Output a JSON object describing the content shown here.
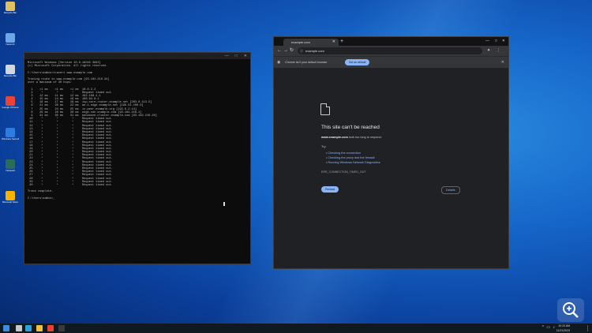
{
  "desktop": {
    "icons": [
      {
        "name": "Recycle Bin",
        "color": "#e0c060"
      },
      {
        "name": "Network",
        "color": "#6aa8e8"
      },
      {
        "name": "Recycle Bin",
        "color": "#cfd8e0"
      },
      {
        "name": "Google Chrome",
        "color": "#ea4335"
      },
      {
        "name": "Windows Security",
        "color": "#2d7de0"
      },
      {
        "name": "Notepad",
        "color": "#2a6b5a"
      },
      {
        "name": "Microsoft Store",
        "color": "#f4b400"
      }
    ]
  },
  "terminal": {
    "title_buttons": [
      "—",
      "□",
      "✕"
    ],
    "lines": [
      "Microsoft Windows [Version 10.0.19045.3693]",
      "(c) Microsoft Corporation. All rights reserved.",
      "",
      "C:\\Users\\admin>tracert www.example.com",
      "",
      "Tracing route to www.example.com [93.184.216.34]",
      "over a maximum of 30 hops:",
      "",
      "  1    <1 ms    <1 ms    <1 ms  10.0.2.2",
      "  2     *        *        *     Request timed out.",
      "  3    12 ms    11 ms    12 ms  192.168.1.1",
      "  4    15 ms    14 ms    16 ms  100.64.0.1",
      "  5    18 ms    17 ms    18 ms  isp-core-router.example.net [203.0.113.5]",
      "  6    21 ms    20 ms    22 ms  ae-1.edge.example.net [198.51.100.9]",
      "  7    25 ms    24 ms    25 ms  ix-peer.example.org [192.0.2.14]",
      "  8    29 ms    28 ms    30 ms  edge-cdn.example.com [93.184.216.1]",
      "  9    31 ms    30 ms    31 ms  backbone-cluster.example.com [93.184.216.20]",
      " 10     *        *        *     Request timed out.",
      " 11     *        *        *     Request timed out.",
      " 12     *        *        *     Request timed out.",
      " 13     *        *        *     Request timed out.",
      " 14     *        *        *     Request timed out.",
      " 15     *        *        *     Request timed out.",
      " 16     *        *        *     Request timed out.",
      " 17     *        *        *     Request timed out.",
      " 18     *        *        *     Request timed out.",
      " 19     *        *        *     Request timed out.",
      " 20     *        *        *     Request timed out.",
      " 21     *        *        *     Request timed out.",
      " 22     *        *        *     Request timed out.",
      " 23     *        *        *     Request timed out.",
      " 24     *        *        *     Request timed out.",
      " 25     *        *        *     Request timed out.",
      " 26     *        *        *     Request timed out.",
      " 27     *        *        *     Request timed out.",
      " 28     *        *        *     Request timed out.",
      " 29     *        *        *     Request timed out.",
      " 30     *        *        *     Request timed out.",
      "",
      "Trace complete.",
      "",
      "C:\\Users\\admin>_"
    ]
  },
  "browser": {
    "tab_title": "example.com",
    "tab_close": "✕",
    "new_tab": "+",
    "window_buttons": [
      "—",
      "□",
      "✕"
    ],
    "nav": {
      "back": "←",
      "forward": "→",
      "reload": "↻"
    },
    "url": "example.com",
    "infobar": {
      "text": "Chrome isn't your default browser",
      "button": "Set as default",
      "close": "✕"
    },
    "error": {
      "heading": "This site can't be reached",
      "host": "www.example.com",
      "message": "took too long to respond.",
      "try_label": "Try:",
      "suggestions": [
        "Checking the connection",
        "Checking the proxy and the firewall",
        "Running Windows Network Diagnostics"
      ],
      "code": "ERR_CONNECTION_TIMED_OUT",
      "reload": "Reload",
      "details": "Details"
    }
  },
  "taskbar": {
    "time": "10:24 AM",
    "date": "11/21/2023",
    "items": [
      {
        "name": "start",
        "color": "#3a8ee6"
      },
      {
        "name": "search",
        "color": "#c8c8c8"
      },
      {
        "name": "edge",
        "color": "#2aa3d8"
      },
      {
        "name": "explorer",
        "color": "#f0c040"
      },
      {
        "name": "chrome",
        "color": "#ea4335"
      },
      {
        "name": "terminal",
        "color": "#3a3a3a"
      }
    ]
  }
}
